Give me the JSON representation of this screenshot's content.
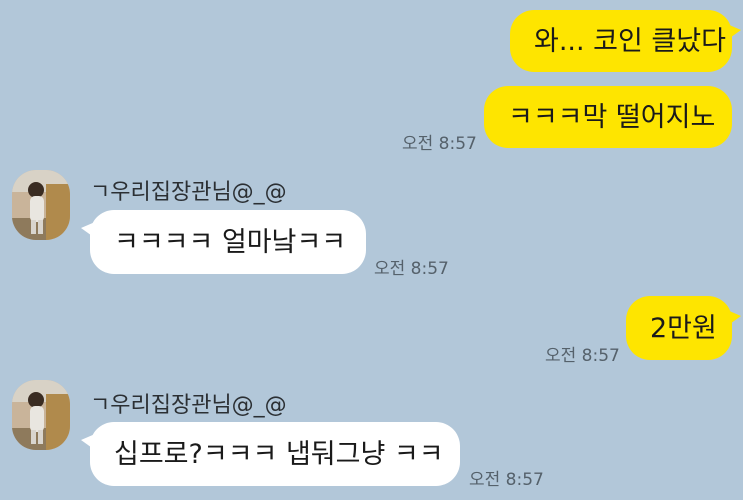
{
  "messages": [
    {
      "side": "mine",
      "text": "와... 코인 클났다"
    },
    {
      "side": "mine",
      "text": "ㅋㅋㅋ막 떨어지노",
      "time": "오전 8:57"
    },
    {
      "side": "theirs",
      "sender": "ㄱ우리집장관님@_@",
      "text": "ㅋㅋㅋㅋ 얼마낰ㅋㅋ",
      "time": "오전 8:57"
    },
    {
      "side": "mine",
      "text": "2만원",
      "time": "오전 8:57"
    },
    {
      "side": "theirs",
      "sender": "ㄱ우리집장관님@_@",
      "text": "십프로?ㅋㅋㅋ 냅둬그냥 ㅋㅋ",
      "time": "오전 8:57"
    }
  ],
  "colors": {
    "background": "#b2c7d9",
    "my_bubble": "#fee500",
    "their_bubble": "#ffffff",
    "timestamp": "#55616b"
  },
  "icons": {
    "avatar": "profile-photo-avatar"
  }
}
